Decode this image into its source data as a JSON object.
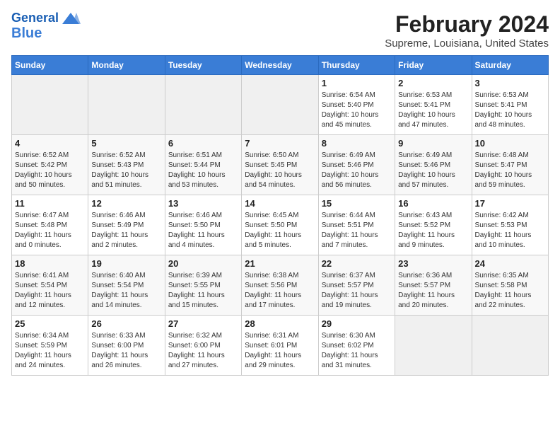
{
  "header": {
    "logo_line1": "General",
    "logo_line2": "Blue",
    "title": "February 2024",
    "subtitle": "Supreme, Louisiana, United States"
  },
  "weekdays": [
    "Sunday",
    "Monday",
    "Tuesday",
    "Wednesday",
    "Thursday",
    "Friday",
    "Saturday"
  ],
  "weeks": [
    [
      {
        "day": "",
        "info": ""
      },
      {
        "day": "",
        "info": ""
      },
      {
        "day": "",
        "info": ""
      },
      {
        "day": "",
        "info": ""
      },
      {
        "day": "1",
        "info": "Sunrise: 6:54 AM\nSunset: 5:40 PM\nDaylight: 10 hours\nand 45 minutes."
      },
      {
        "day": "2",
        "info": "Sunrise: 6:53 AM\nSunset: 5:41 PM\nDaylight: 10 hours\nand 47 minutes."
      },
      {
        "day": "3",
        "info": "Sunrise: 6:53 AM\nSunset: 5:41 PM\nDaylight: 10 hours\nand 48 minutes."
      }
    ],
    [
      {
        "day": "4",
        "info": "Sunrise: 6:52 AM\nSunset: 5:42 PM\nDaylight: 10 hours\nand 50 minutes."
      },
      {
        "day": "5",
        "info": "Sunrise: 6:52 AM\nSunset: 5:43 PM\nDaylight: 10 hours\nand 51 minutes."
      },
      {
        "day": "6",
        "info": "Sunrise: 6:51 AM\nSunset: 5:44 PM\nDaylight: 10 hours\nand 53 minutes."
      },
      {
        "day": "7",
        "info": "Sunrise: 6:50 AM\nSunset: 5:45 PM\nDaylight: 10 hours\nand 54 minutes."
      },
      {
        "day": "8",
        "info": "Sunrise: 6:49 AM\nSunset: 5:46 PM\nDaylight: 10 hours\nand 56 minutes."
      },
      {
        "day": "9",
        "info": "Sunrise: 6:49 AM\nSunset: 5:46 PM\nDaylight: 10 hours\nand 57 minutes."
      },
      {
        "day": "10",
        "info": "Sunrise: 6:48 AM\nSunset: 5:47 PM\nDaylight: 10 hours\nand 59 minutes."
      }
    ],
    [
      {
        "day": "11",
        "info": "Sunrise: 6:47 AM\nSunset: 5:48 PM\nDaylight: 11 hours\nand 0 minutes."
      },
      {
        "day": "12",
        "info": "Sunrise: 6:46 AM\nSunset: 5:49 PM\nDaylight: 11 hours\nand 2 minutes."
      },
      {
        "day": "13",
        "info": "Sunrise: 6:46 AM\nSunset: 5:50 PM\nDaylight: 11 hours\nand 4 minutes."
      },
      {
        "day": "14",
        "info": "Sunrise: 6:45 AM\nSunset: 5:50 PM\nDaylight: 11 hours\nand 5 minutes."
      },
      {
        "day": "15",
        "info": "Sunrise: 6:44 AM\nSunset: 5:51 PM\nDaylight: 11 hours\nand 7 minutes."
      },
      {
        "day": "16",
        "info": "Sunrise: 6:43 AM\nSunset: 5:52 PM\nDaylight: 11 hours\nand 9 minutes."
      },
      {
        "day": "17",
        "info": "Sunrise: 6:42 AM\nSunset: 5:53 PM\nDaylight: 11 hours\nand 10 minutes."
      }
    ],
    [
      {
        "day": "18",
        "info": "Sunrise: 6:41 AM\nSunset: 5:54 PM\nDaylight: 11 hours\nand 12 minutes."
      },
      {
        "day": "19",
        "info": "Sunrise: 6:40 AM\nSunset: 5:54 PM\nDaylight: 11 hours\nand 14 minutes."
      },
      {
        "day": "20",
        "info": "Sunrise: 6:39 AM\nSunset: 5:55 PM\nDaylight: 11 hours\nand 15 minutes."
      },
      {
        "day": "21",
        "info": "Sunrise: 6:38 AM\nSunset: 5:56 PM\nDaylight: 11 hours\nand 17 minutes."
      },
      {
        "day": "22",
        "info": "Sunrise: 6:37 AM\nSunset: 5:57 PM\nDaylight: 11 hours\nand 19 minutes."
      },
      {
        "day": "23",
        "info": "Sunrise: 6:36 AM\nSunset: 5:57 PM\nDaylight: 11 hours\nand 20 minutes."
      },
      {
        "day": "24",
        "info": "Sunrise: 6:35 AM\nSunset: 5:58 PM\nDaylight: 11 hours\nand 22 minutes."
      }
    ],
    [
      {
        "day": "25",
        "info": "Sunrise: 6:34 AM\nSunset: 5:59 PM\nDaylight: 11 hours\nand 24 minutes."
      },
      {
        "day": "26",
        "info": "Sunrise: 6:33 AM\nSunset: 6:00 PM\nDaylight: 11 hours\nand 26 minutes."
      },
      {
        "day": "27",
        "info": "Sunrise: 6:32 AM\nSunset: 6:00 PM\nDaylight: 11 hours\nand 27 minutes."
      },
      {
        "day": "28",
        "info": "Sunrise: 6:31 AM\nSunset: 6:01 PM\nDaylight: 11 hours\nand 29 minutes."
      },
      {
        "day": "29",
        "info": "Sunrise: 6:30 AM\nSunset: 6:02 PM\nDaylight: 11 hours\nand 31 minutes."
      },
      {
        "day": "",
        "info": ""
      },
      {
        "day": "",
        "info": ""
      }
    ]
  ]
}
